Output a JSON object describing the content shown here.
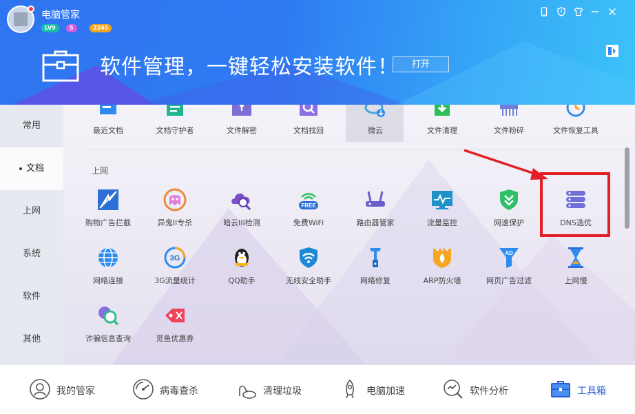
{
  "app": {
    "title": "电脑管家",
    "level_badge": "LV9",
    "msg_badge": "5",
    "coin_badge": "2245"
  },
  "window_controls": [
    "phone-icon",
    "shield-icon",
    "shirt-icon",
    "minimize-icon",
    "close-icon"
  ],
  "banner": {
    "title": "软件管理，一键轻松安装软件！",
    "open_label": "打开"
  },
  "sidebar": {
    "items": [
      {
        "label": "常用"
      },
      {
        "label": "文档"
      },
      {
        "label": "上网"
      },
      {
        "label": "系统"
      },
      {
        "label": "软件"
      },
      {
        "label": "其他"
      }
    ],
    "active": "文档"
  },
  "documents": {
    "tools": [
      {
        "label": "最近文档",
        "icon": "recent-docs-icon"
      },
      {
        "label": "文档守护者",
        "icon": "doc-guardian-icon"
      },
      {
        "label": "文件解密",
        "icon": "file-decrypt-icon"
      },
      {
        "label": "文档找回",
        "icon": "doc-recover-icon"
      },
      {
        "label": "微云",
        "icon": "weiyun-icon"
      },
      {
        "label": "文件清理",
        "icon": "file-clean-icon"
      },
      {
        "label": "文件粉碎",
        "icon": "file-shredder-icon"
      },
      {
        "label": "文件恢复工具",
        "icon": "file-restore-icon"
      }
    ]
  },
  "internet": {
    "section_title": "上网",
    "tools": [
      {
        "label": "购物广告拦截",
        "icon": "ad-block-icon"
      },
      {
        "label": "异鬼II专杀",
        "icon": "ghost-killer-icon"
      },
      {
        "label": "暗云III检测",
        "icon": "dark-cloud-scan-icon"
      },
      {
        "label": "免费WiFi",
        "icon": "free-wifi-icon",
        "badge": "FREE"
      },
      {
        "label": "路由器管家",
        "icon": "router-icon"
      },
      {
        "label": "流量监控",
        "icon": "traffic-monitor-icon"
      },
      {
        "label": "网速保护",
        "icon": "speed-shield-icon"
      },
      {
        "label": "DNS选优",
        "icon": "dns-server-icon"
      },
      {
        "label": "网络连接",
        "icon": "globe-icon"
      },
      {
        "label": "3G流量统计",
        "icon": "3g-icon",
        "badge": "3G"
      },
      {
        "label": "QQ助手",
        "icon": "qq-penguin-icon"
      },
      {
        "label": "无线安全助手",
        "icon": "wifi-shield-icon"
      },
      {
        "label": "网络修复",
        "icon": "network-repair-icon"
      },
      {
        "label": "ARP防火墙",
        "icon": "arp-firewall-icon"
      },
      {
        "label": "网页广告过滤",
        "icon": "ad-filter-icon",
        "badge": "AD"
      },
      {
        "label": "上网慢",
        "icon": "hourglass-icon"
      },
      {
        "label": "诈骗信息查询",
        "icon": "fraud-search-icon"
      },
      {
        "label": "觅鱼优惠券",
        "icon": "coupon-icon"
      }
    ]
  },
  "bottom_nav": {
    "items": [
      {
        "label": "我的管家",
        "icon": "butler-icon"
      },
      {
        "label": "病毒查杀",
        "icon": "virus-scan-icon"
      },
      {
        "label": "清理垃圾",
        "icon": "vacuum-icon"
      },
      {
        "label": "电脑加速",
        "icon": "rocket-icon"
      },
      {
        "label": "软件分析",
        "icon": "analysis-icon"
      },
      {
        "label": "工具箱",
        "icon": "toolbox-icon"
      }
    ],
    "active": "工具箱"
  },
  "colors": {
    "header_start": "#2f74f0",
    "header_end": "#3cc3f8",
    "accent": "#2b5fd9",
    "highlight": "#e21e26"
  }
}
